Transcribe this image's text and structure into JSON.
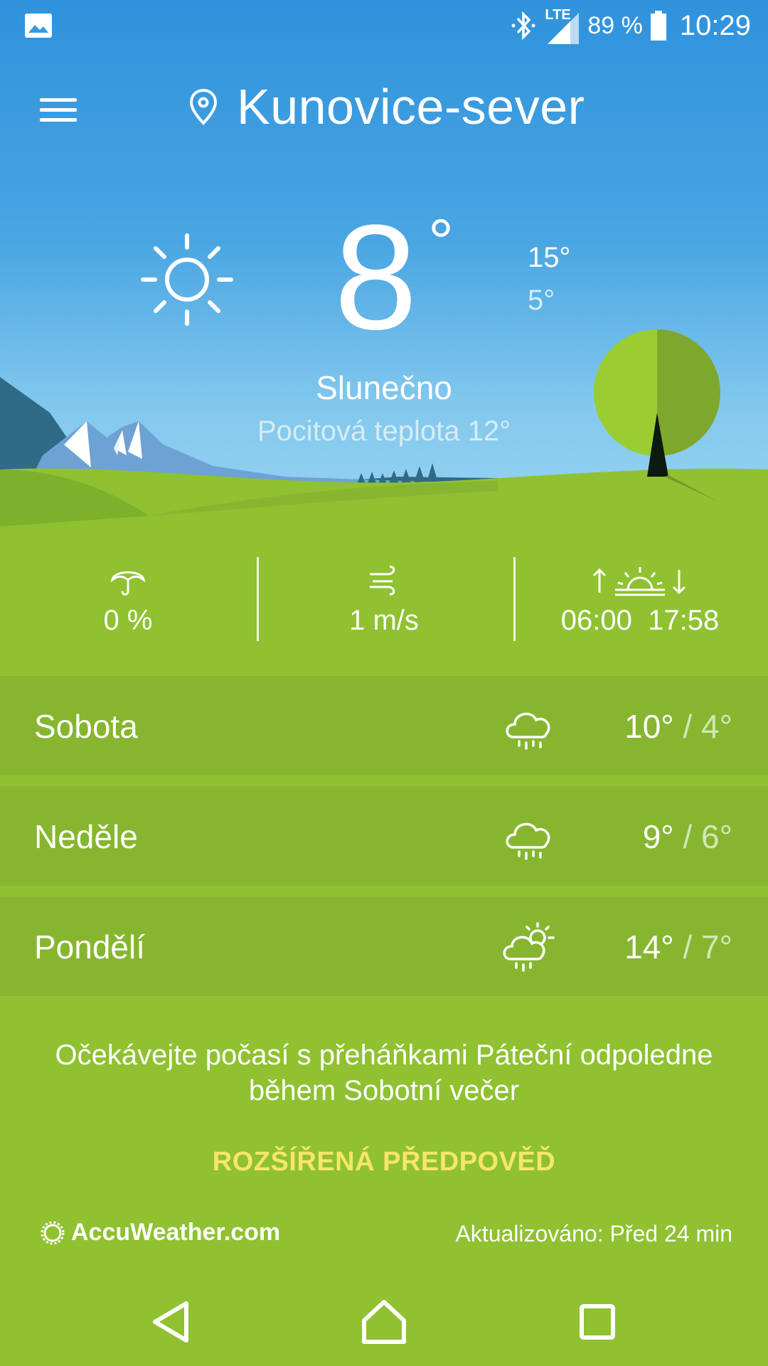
{
  "status": {
    "network": "LTE",
    "battery": "89 %",
    "time": "10:29"
  },
  "location": {
    "name": "Kunovice-sever"
  },
  "current": {
    "temp": "8",
    "deg": "°",
    "high": "15°",
    "low": "5°",
    "condition": "Slunečno",
    "feels_like": "Pocitová teplota 12°"
  },
  "details": {
    "precip": "0 %",
    "wind": "1 m/s",
    "sunrise": "06:00",
    "sunset": "17:58"
  },
  "forecast": [
    {
      "day": "Sobota",
      "high": "10°",
      "sep": "/",
      "low": "4°",
      "icon": "cloud-rain-icon"
    },
    {
      "day": "Neděle",
      "high": "9°",
      "sep": "/",
      "low": "6°",
      "icon": "cloud-rain-icon"
    },
    {
      "day": "Pondělí",
      "high": "14°",
      "sep": "/",
      "low": "7°",
      "icon": "partly-sunny-rain-icon"
    }
  ],
  "headline": "Očekávejte počasí s přeháňkami Páteční odpoledne během Sobotní večer",
  "extended_label": "ROZŠÍŘENÁ PŘEDPOVĚĎ",
  "brand": "AccuWeather.com",
  "updated": "Aktualizováno: Před 24 min",
  "colors": {
    "sky_top": "#2f92dc",
    "grass": "#8fc131",
    "row": "#86b62f",
    "accent": "#f6e66a"
  }
}
